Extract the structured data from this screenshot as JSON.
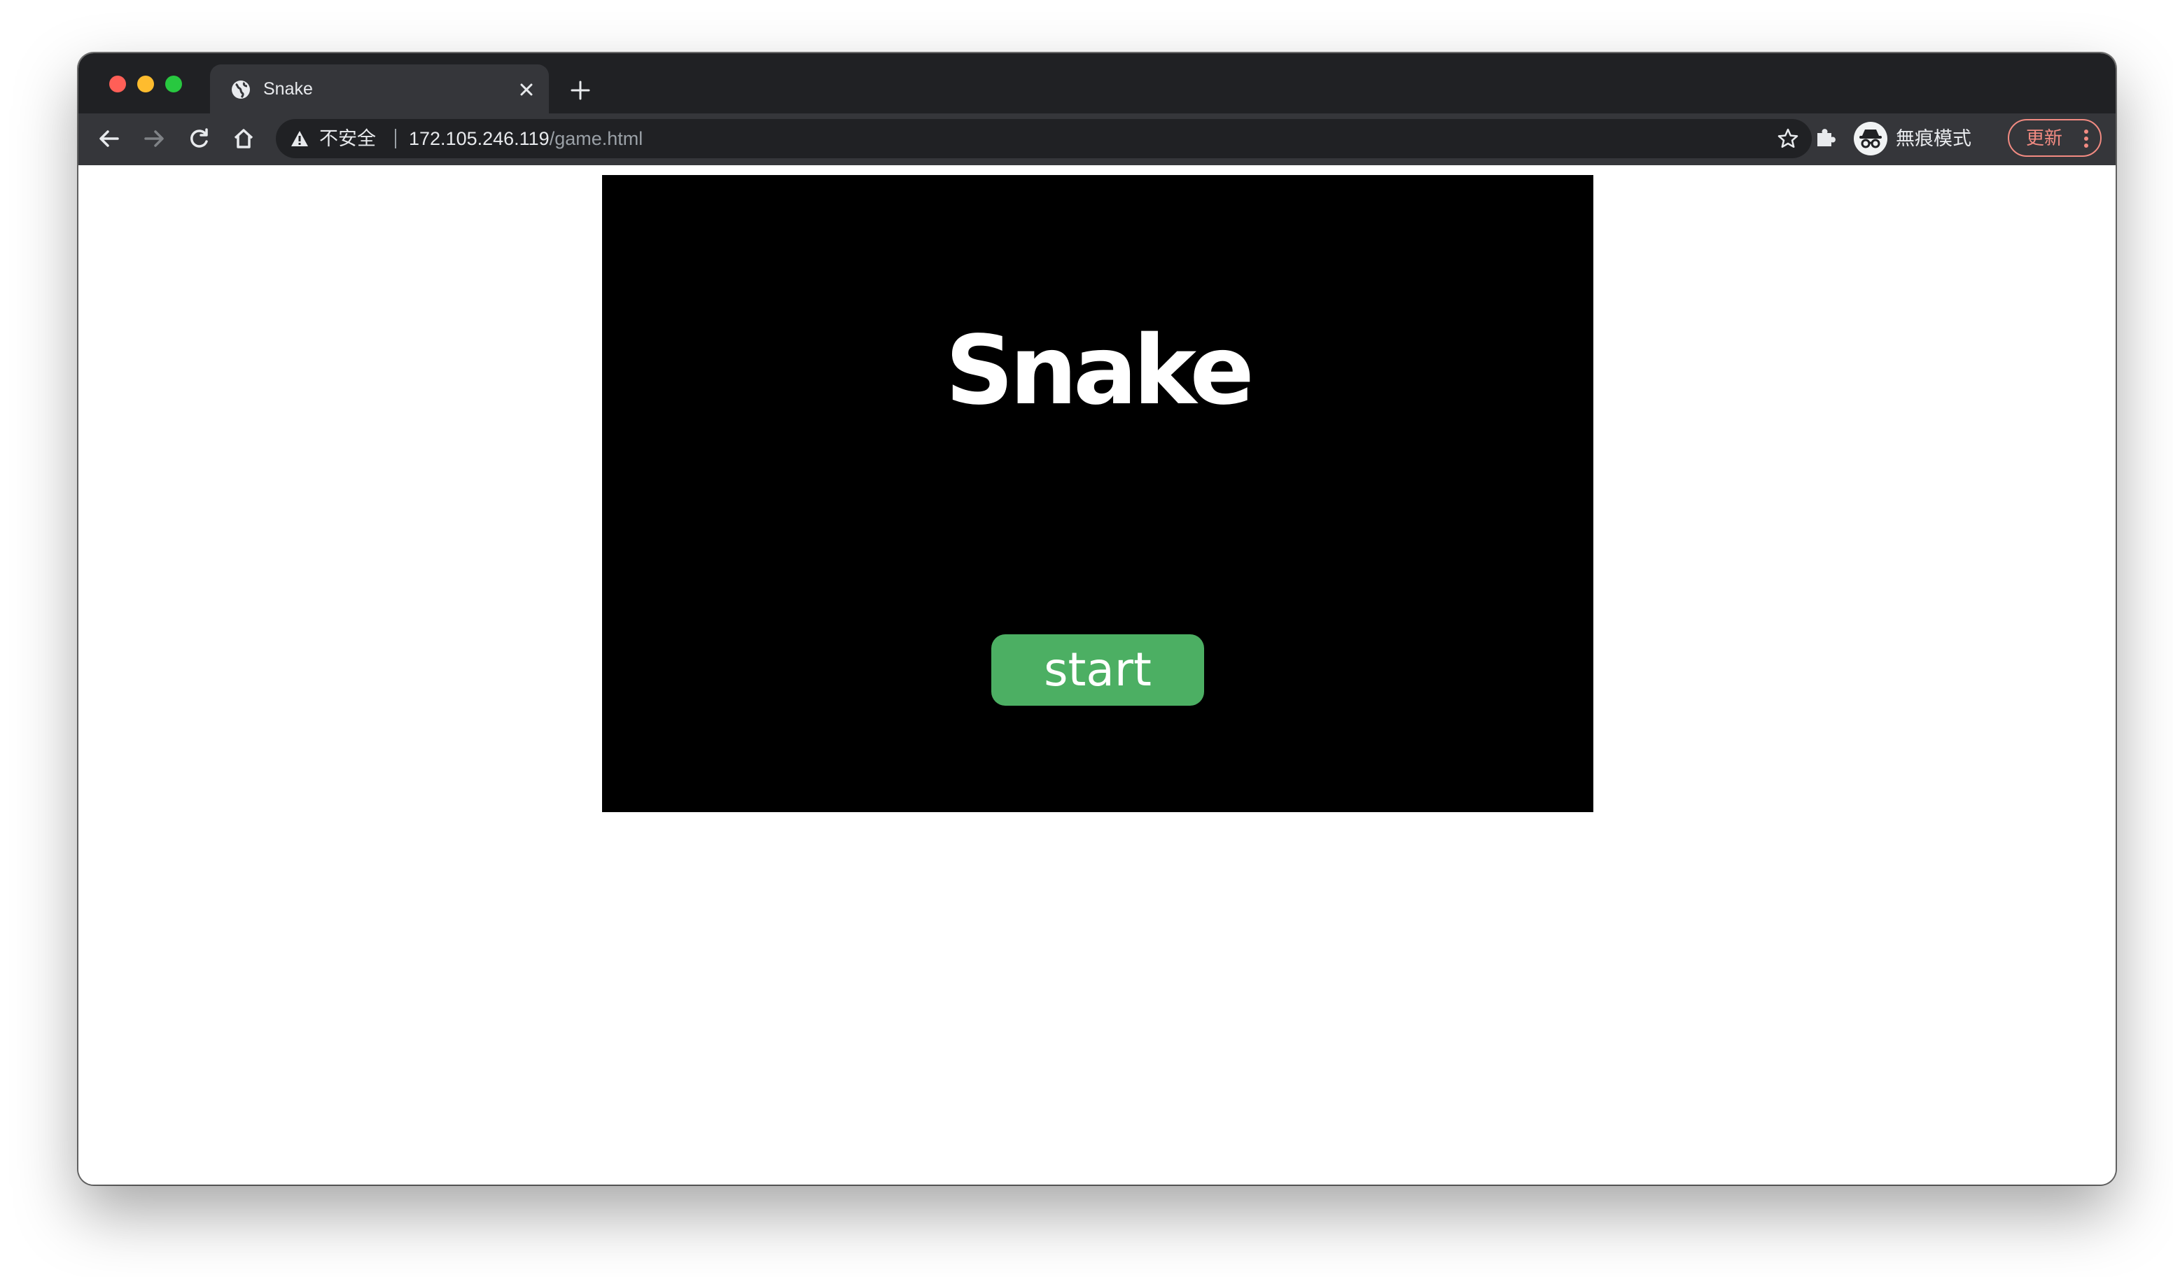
{
  "browser": {
    "tab": {
      "title": "Snake",
      "icon": "globe-icon"
    },
    "address_bar": {
      "security_label": "不安全",
      "host": "172.105.246.119",
      "path": "/game.html"
    },
    "profile": {
      "label": "無痕模式",
      "icon": "incognito-icon"
    },
    "update_label": "更新"
  },
  "game": {
    "title": "Snake",
    "start_label": "start",
    "colors": {
      "canvas": "#000000",
      "start_button": "#4caf63",
      "text": "#ffffff"
    }
  }
}
